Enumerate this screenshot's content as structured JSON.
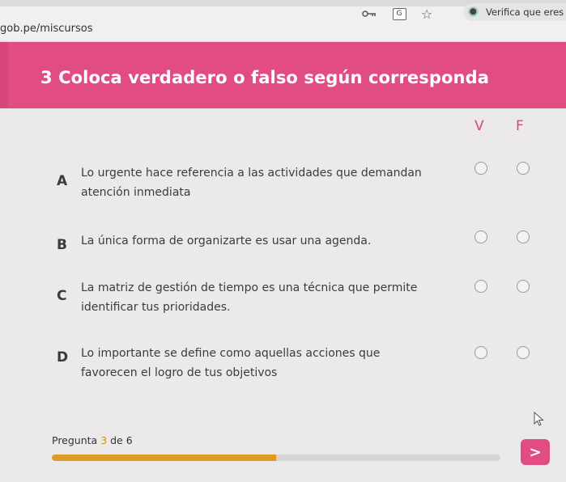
{
  "browser": {
    "url": "gob.pe/miscursos",
    "profile_chip": "Verifica que eres",
    "icons": [
      "key-icon",
      "translate-icon",
      "star-icon"
    ]
  },
  "question": {
    "number_title": "3  Coloca verdadero o falso según corresponda"
  },
  "columns": {
    "true_label": "V",
    "false_label": "F"
  },
  "items": [
    {
      "letter": "A",
      "text": "Lo urgente hace referencia a las actividades que demandan atención inmediata"
    },
    {
      "letter": "B",
      "text": "La única forma de organizarte es usar una agenda."
    },
    {
      "letter": "C",
      "text": "La matriz de gestión de tiempo es una técnica que permite identificar tus prioridades."
    },
    {
      "letter": "D",
      "text": "Lo importante se define como aquellas acciones que favorecen el logro de tus objetivos"
    }
  ],
  "progress": {
    "prefix": "Pregunta ",
    "current": "3",
    "separator": " de ",
    "total": "6",
    "fraction": 0.5
  },
  "next_button": {
    "label": ">"
  },
  "colors": {
    "accent": "#e14c83",
    "progress": "#dd9b26"
  }
}
